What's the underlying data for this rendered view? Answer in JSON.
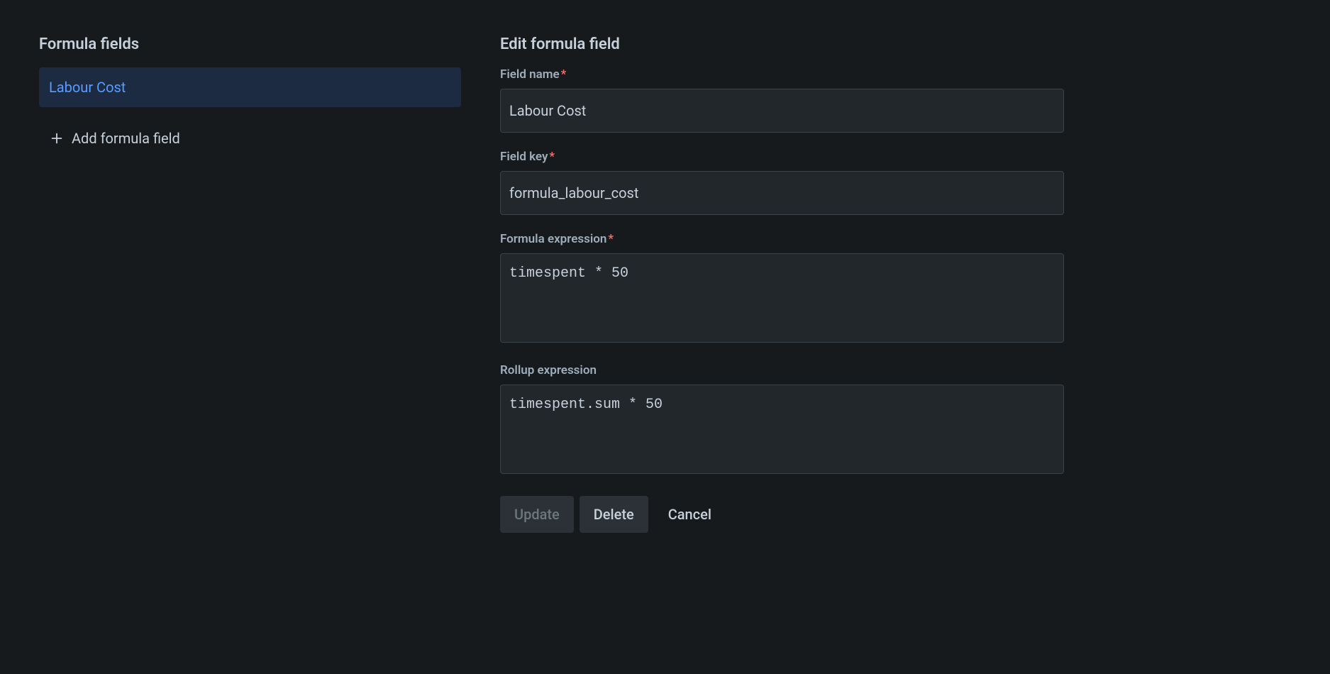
{
  "sidebar": {
    "title": "Formula fields",
    "items": [
      {
        "label": "Labour Cost"
      }
    ],
    "add_button": "Add formula field"
  },
  "editor": {
    "title": "Edit formula field",
    "fields": {
      "field_name": {
        "label": "Field name",
        "required": true,
        "value": "Labour Cost"
      },
      "field_key": {
        "label": "Field key",
        "required": true,
        "value": "formula_labour_cost"
      },
      "formula_expression": {
        "label": "Formula expression",
        "required": true,
        "value": "timespent * 50"
      },
      "rollup_expression": {
        "label": "Rollup expression",
        "required": false,
        "value": "timespent.sum * 50"
      }
    },
    "buttons": {
      "update": "Update",
      "delete": "Delete",
      "cancel": "Cancel"
    }
  }
}
